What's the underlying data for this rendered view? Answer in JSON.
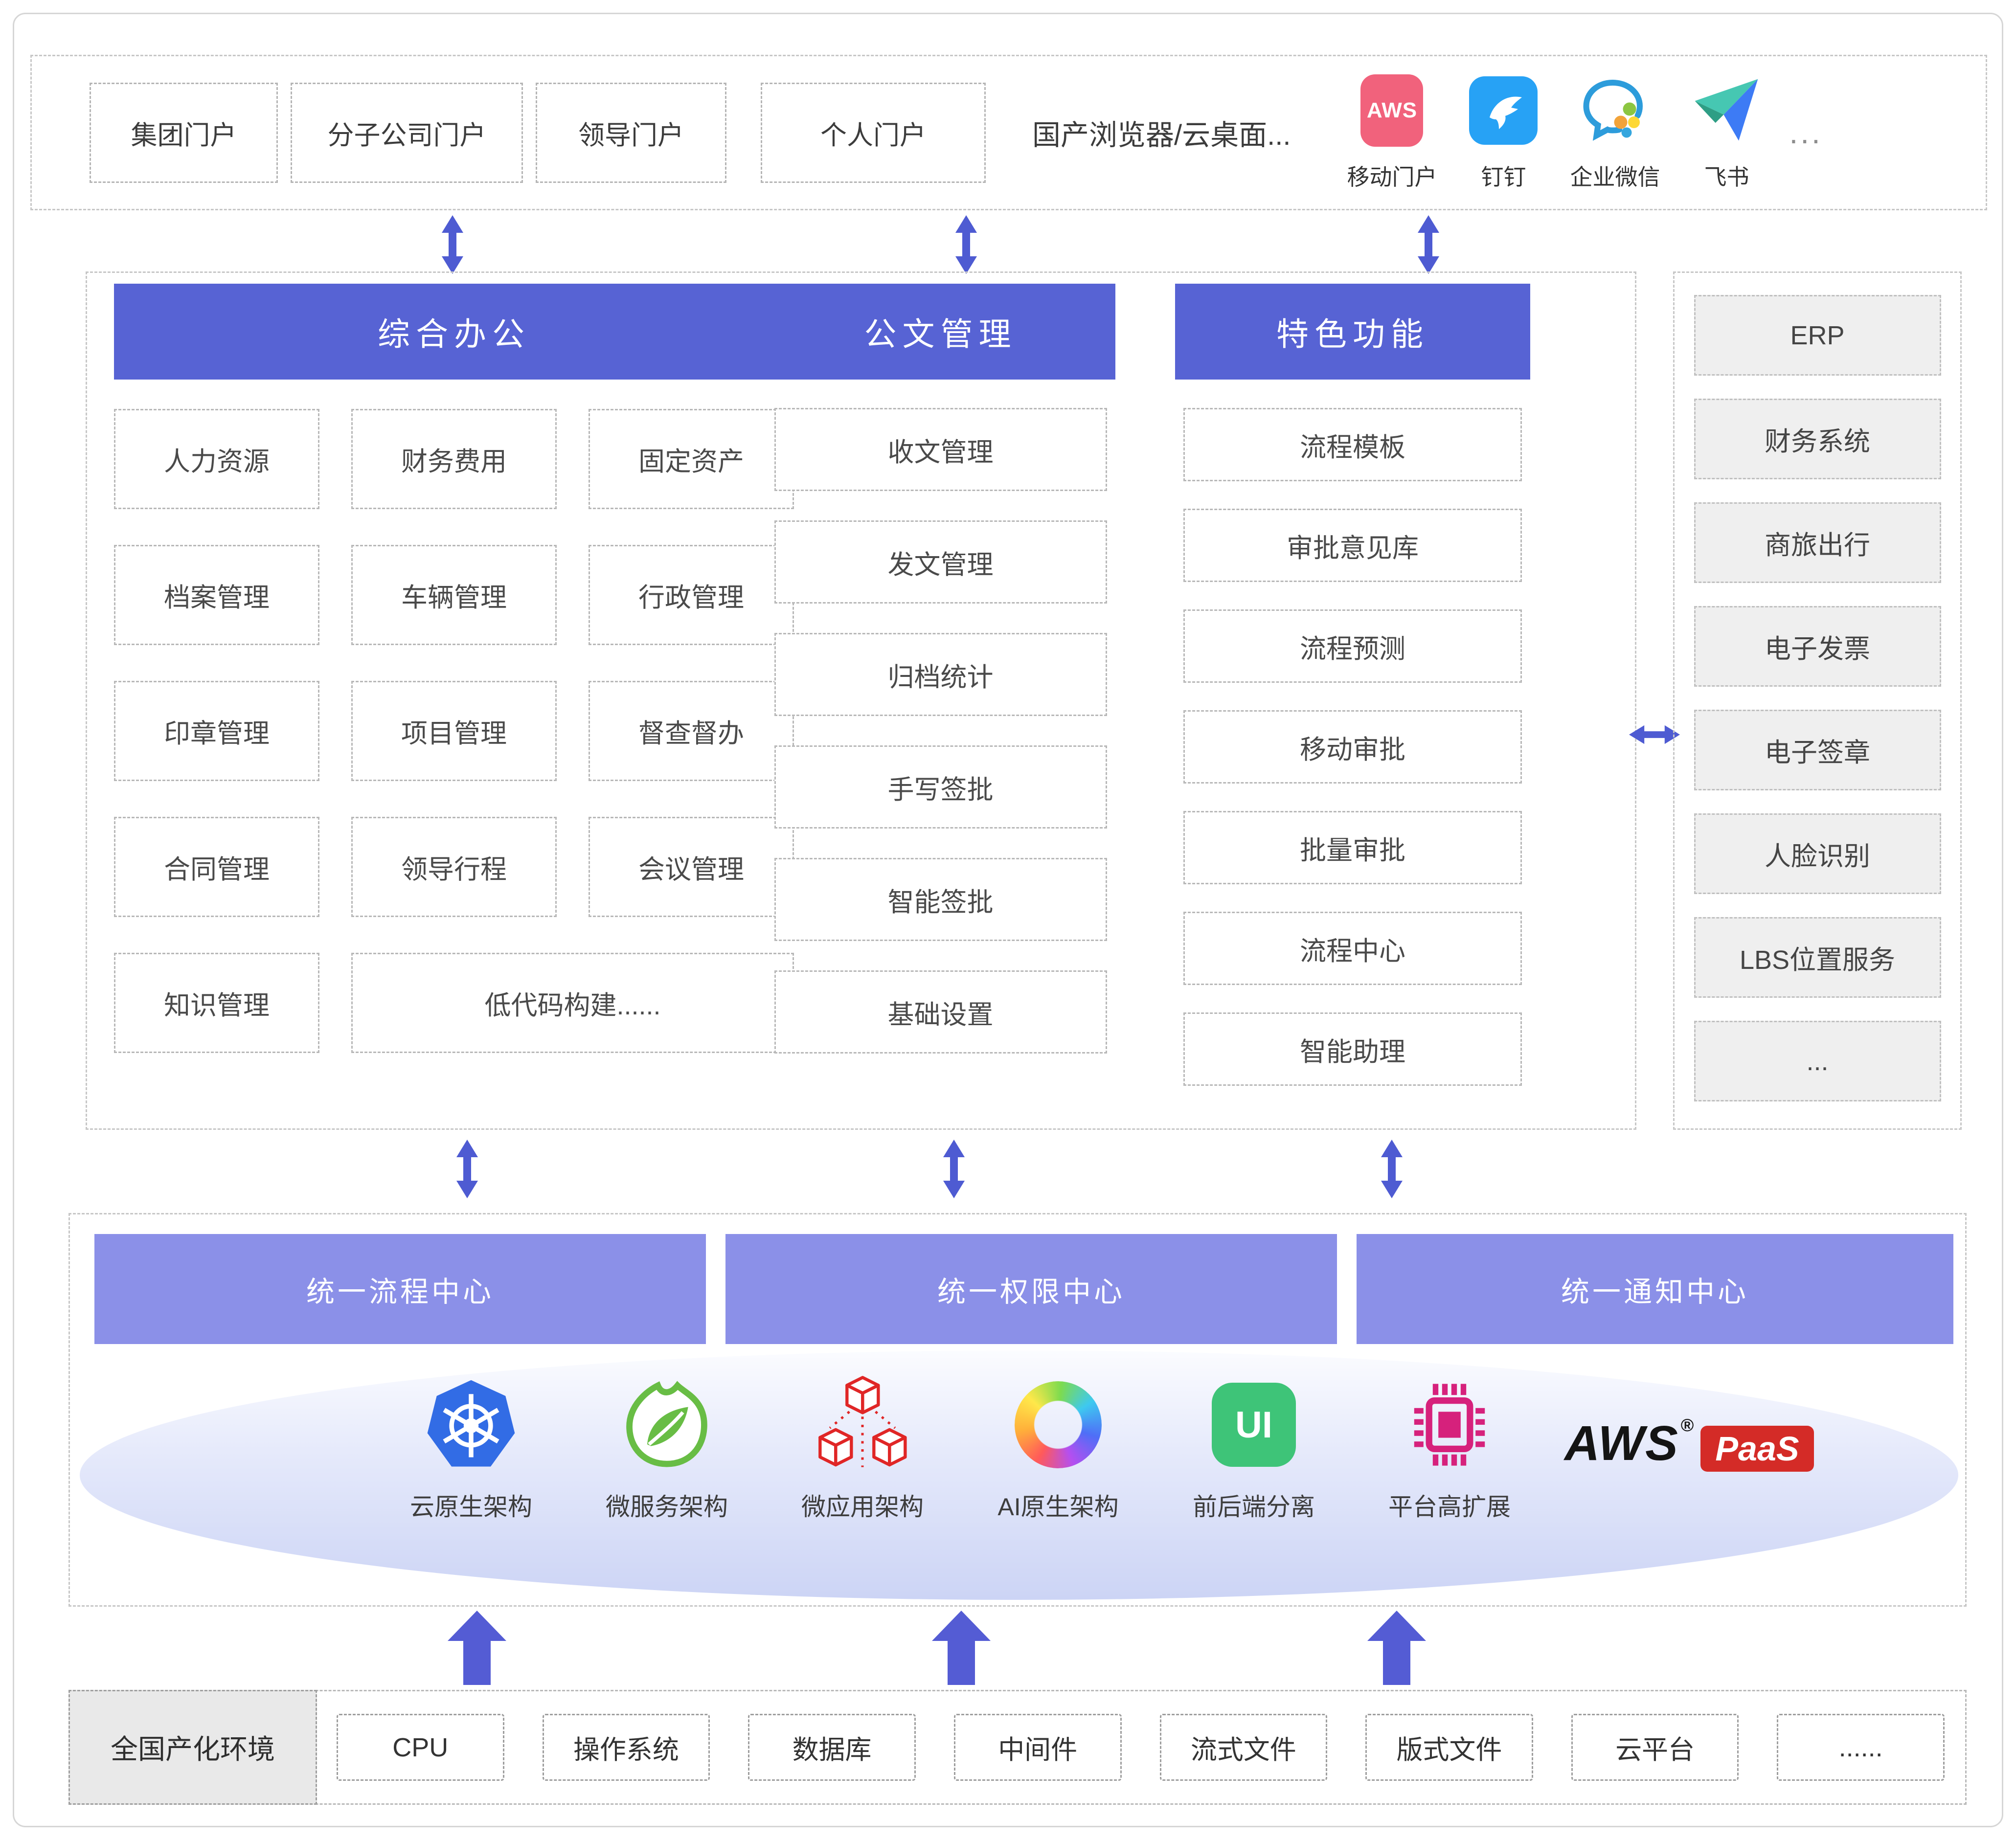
{
  "colors": {
    "accent": "#5763d4",
    "bar": "#8b90e8",
    "arrow": "#4e5bd2",
    "aws_red": "#d42b27",
    "aws_pink": "#f1627c"
  },
  "top": {
    "portals": [
      "集团门户",
      "分子公司门户",
      "领导门户",
      "个人门户"
    ],
    "browser_text": "国产浏览器/云桌面...",
    "apps": [
      {
        "icon": "aws-mobile-icon",
        "icon_text": "AWS",
        "label": "移动门户"
      },
      {
        "icon": "dingtalk-icon",
        "label": "钉钉"
      },
      {
        "icon": "wecom-icon",
        "label": "企业微信"
      },
      {
        "icon": "feishu-icon",
        "label": "飞书"
      }
    ],
    "more": "..."
  },
  "columns": [
    {
      "title": "综合办公",
      "items": [
        "人力资源",
        "财务费用",
        "固定资产",
        "档案管理",
        "车辆管理",
        "行政管理",
        "印章管理",
        "项目管理",
        "督查督办",
        "合同管理",
        "领导行程",
        "会议管理",
        "知识管理",
        "低代码构建......"
      ]
    },
    {
      "title": "公文管理",
      "items": [
        "收文管理",
        "发文管理",
        "归档统计",
        "手写签批",
        "智能签批",
        "基础设置"
      ]
    },
    {
      "title": "特色功能",
      "items": [
        "流程模板",
        "审批意见库",
        "流程预测",
        "移动审批",
        "批量审批",
        "流程中心",
        "智能助理"
      ]
    }
  ],
  "services": {
    "items": [
      "ERP",
      "财务系统",
      "商旅出行",
      "电子发票",
      "电子签章",
      "人脸识别",
      "LBS位置服务",
      "..."
    ]
  },
  "bars": [
    "统一流程中心",
    "统一权限中心",
    "统一通知中心"
  ],
  "platform": {
    "features": [
      {
        "icon": "kubernetes-icon",
        "label": "云原生架构"
      },
      {
        "icon": "spring-icon",
        "label": "微服务架构"
      },
      {
        "icon": "micro-app-cubes-icon",
        "label": "微应用架构"
      },
      {
        "icon": "ai-ring-icon",
        "label": "AI原生架构"
      },
      {
        "icon": "ui-icon",
        "icon_text": "UI",
        "label": "前后端分离"
      },
      {
        "icon": "chip-icon",
        "label": "平台高扩展"
      }
    ],
    "aws_paas": {
      "aws": "AWS",
      "reg": "®",
      "paas": "PaaS"
    }
  },
  "bottom": {
    "env_label": "全国产化环境",
    "items": [
      "CPU",
      "操作系统",
      "数据库",
      "中间件",
      "流式文件",
      "版式文件",
      "云平台",
      "......"
    ]
  }
}
